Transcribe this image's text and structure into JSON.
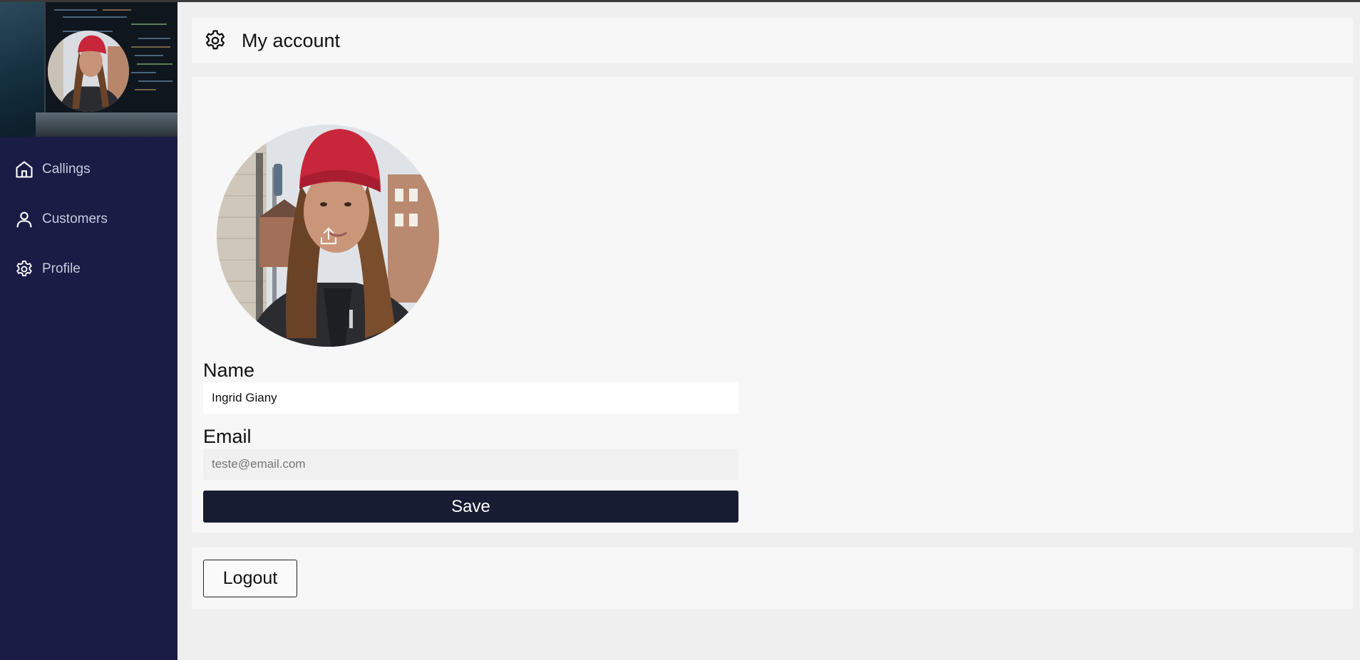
{
  "sidebar": {
    "items": [
      {
        "label": "Callings",
        "icon": "home-icon"
      },
      {
        "label": "Customers",
        "icon": "user-icon"
      },
      {
        "label": "Profile",
        "icon": "gear-icon"
      }
    ]
  },
  "header": {
    "title": "My account",
    "icon": "gear-icon"
  },
  "profile": {
    "avatar_action_icon": "upload-icon",
    "name_label": "Name",
    "name_value": "Ingrid Giany",
    "email_label": "Email",
    "email_placeholder": "teste@email.com",
    "save_label": "Save"
  },
  "logout": {
    "label": "Logout"
  },
  "colors": {
    "sidebar_bg": "#1a1c45",
    "save_button_bg": "#181c33",
    "card_bg": "#f7f7f7",
    "page_bg": "#efefef",
    "beanie": "#c8263a"
  }
}
